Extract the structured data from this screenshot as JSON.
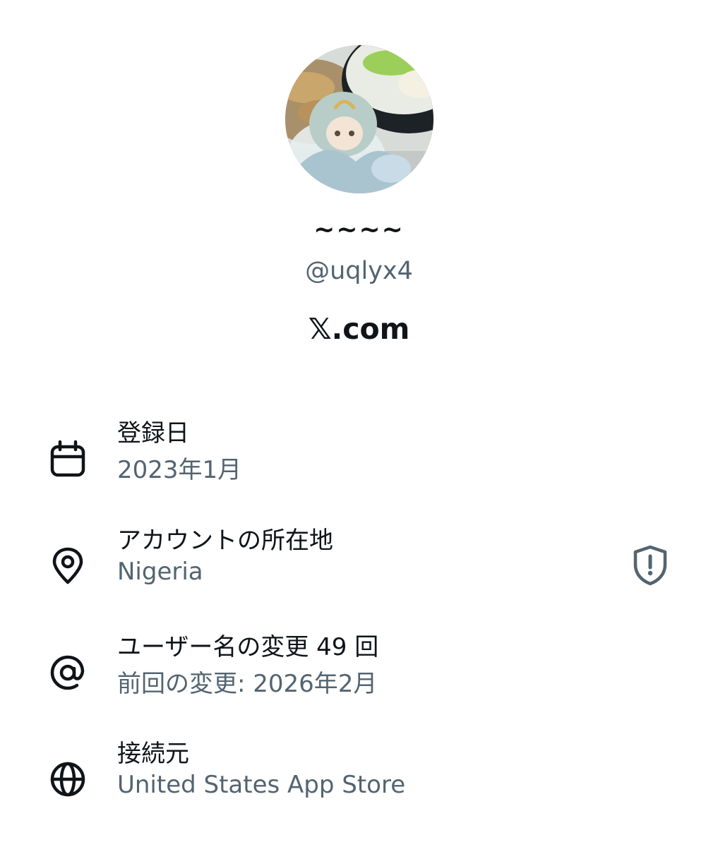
{
  "profile": {
    "display_name": "~~~~",
    "handle": "@uqlyx4",
    "brand": "𝕏.com"
  },
  "rows": [
    {
      "icon": "calendar-icon",
      "label": "登録日",
      "value": "2023年1月"
    },
    {
      "icon": "location-pin-icon",
      "label": "アカウントの所在地",
      "value": "Nigeria",
      "trailing_icon": "shield-alert-icon"
    },
    {
      "icon": "at-sign-icon",
      "label": "ユーザー名の変更 49 回",
      "value": "前回の変更: 2026年2月"
    },
    {
      "icon": "globe-icon",
      "label": "接続元",
      "value": "United States App Store"
    }
  ],
  "colors": {
    "primary_text": "#0f1419",
    "secondary_text": "#536471"
  }
}
